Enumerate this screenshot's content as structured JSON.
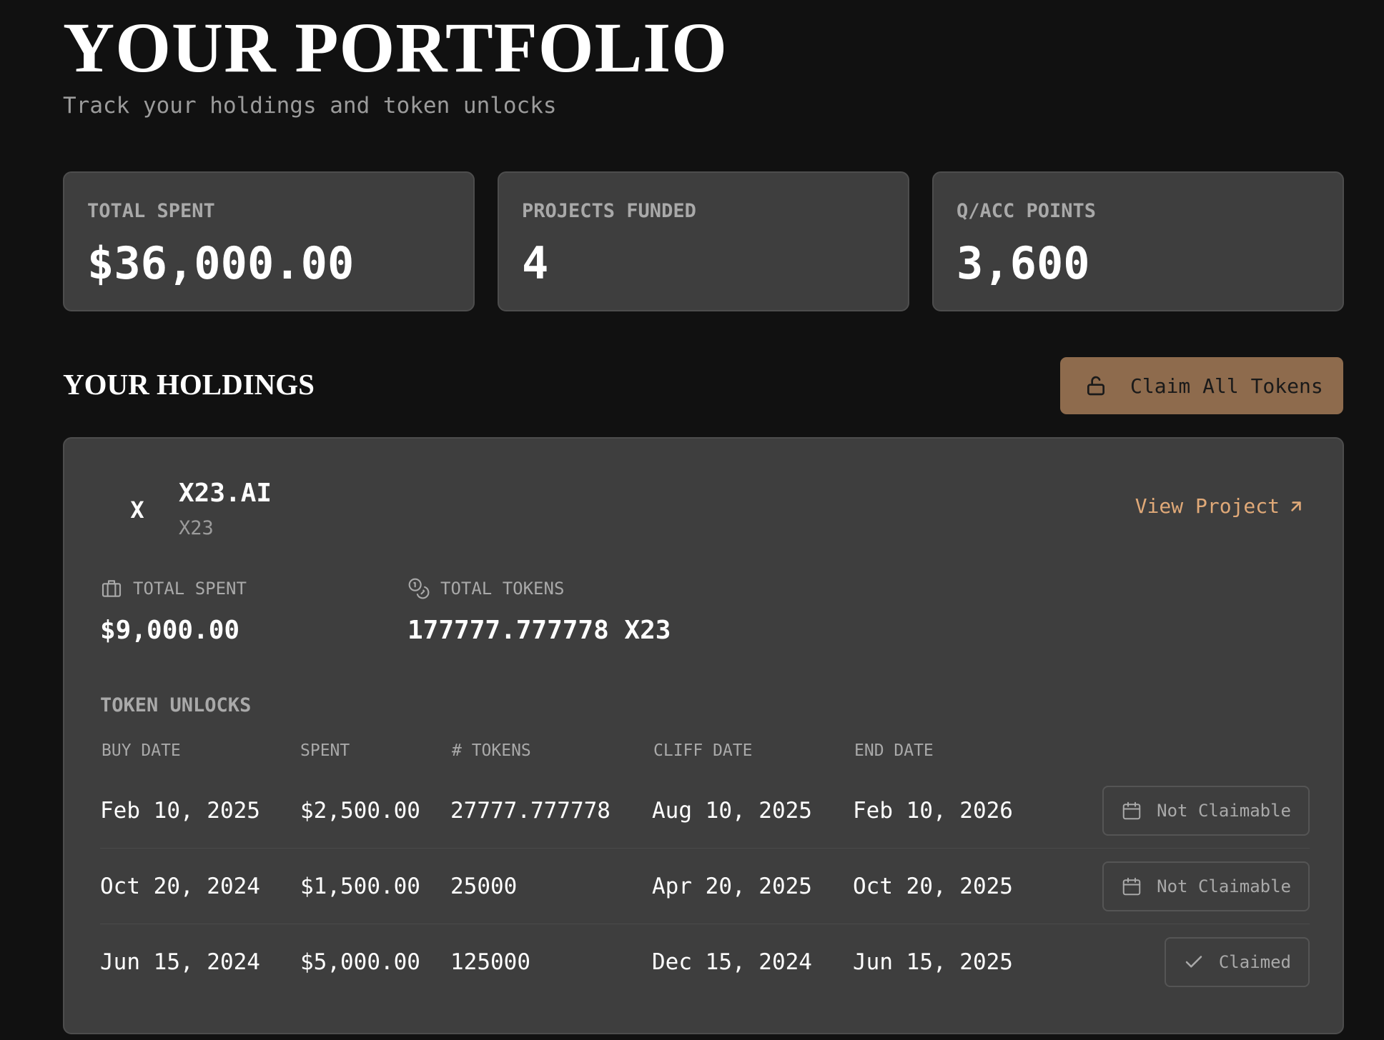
{
  "header": {
    "title": "YOUR PORTFOLIO",
    "subtitle": "Track your holdings and token unlocks"
  },
  "stats": [
    {
      "label": "TOTAL SPENT",
      "value": "$36,000.00"
    },
    {
      "label": "PROJECTS FUNDED",
      "value": "4"
    },
    {
      "label": "Q/ACC POINTS",
      "value": "3,600"
    }
  ],
  "holdings": {
    "title": "YOUR HOLDINGS",
    "claim_all_label": "Claim All Tokens",
    "claim_all_icon": "unlock-icon"
  },
  "project": {
    "avatar": "X",
    "name": "X23.AI",
    "ticker": "X23",
    "view_label": "View Project",
    "view_icon": "arrow-up-right-icon",
    "total_spent_label": "TOTAL SPENT",
    "total_spent_value": "$9,000.00",
    "total_tokens_label": "TOTAL TOKENS",
    "total_tokens_value": "177777.777778 X23",
    "accent_color": "#e0a978"
  },
  "unlocks": {
    "title": "TOKEN UNLOCKS",
    "columns": [
      "BUY DATE",
      "SPENT",
      "# TOKENS",
      "CLIFF DATE",
      "END DATE"
    ],
    "rows": [
      {
        "buy_date": "Feb 10, 2025",
        "spent": "$2,500.00",
        "tokens": "27777.777778",
        "cliff_date": "Aug 10, 2025",
        "end_date": "Feb 10, 2026",
        "status": "Not Claimable",
        "status_icon": "calendar-icon"
      },
      {
        "buy_date": "Oct 20, 2024",
        "spent": "$1,500.00",
        "tokens": "25000",
        "cliff_date": "Apr 20, 2025",
        "end_date": "Oct 20, 2025",
        "status": "Not Claimable",
        "status_icon": "calendar-icon"
      },
      {
        "buy_date": "Jun 15, 2024",
        "spent": "$5,000.00",
        "tokens": "125000",
        "cliff_date": "Dec 15, 2024",
        "end_date": "Jun 15, 2025",
        "status": "Claimed",
        "status_icon": "check-icon"
      }
    ]
  },
  "colors": {
    "background": "#111111",
    "card": "#3e3e3e",
    "accent_button": "#8e6b4d",
    "muted_text": "#a9a9a9"
  }
}
